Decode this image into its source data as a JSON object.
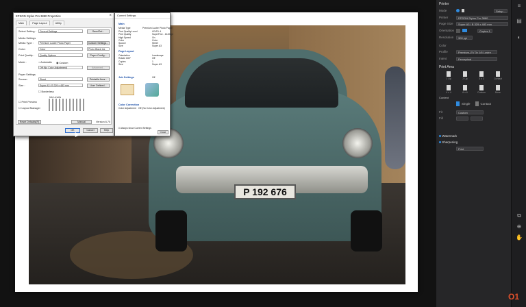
{
  "panel": {
    "title": "Printer",
    "rows": [
      {
        "label": "Mode",
        "value": "",
        "btn": "Setup..."
      },
      {
        "label": "Printer",
        "value": "EPSON Stylus Pro 3880"
      },
      {
        "label": "Page Size",
        "value": "Super A3 / B 329 x 483 mm"
      },
      {
        "label": "Orientation",
        "value": "",
        "extra": "Copies 1"
      },
      {
        "label": "Resolution",
        "value": "300 ppi"
      },
      {
        "label": "Color",
        "value": ""
      },
      {
        "label": "Profile",
        "value": "Premium_EV 3x 1/6 Lustre"
      },
      {
        "label": "Intent",
        "value": "Perceptual"
      }
    ],
    "print_area": "Print Area",
    "tiles": [
      "1 Up",
      "2 Up",
      "3 x 3",
      "Contact",
      "4 x 4",
      "6 x 6",
      "Custom",
      "More"
    ],
    "content": "Content",
    "content_rows": [
      "Single",
      "Contact",
      "Fit",
      "Fill",
      "Custom"
    ],
    "watermark": "Watermark",
    "sharpening": "Sharpening",
    "sharpening_type": "Print"
  },
  "photo": {
    "plate": "P 192 676"
  },
  "dialog1": {
    "title": "EPSON Stylus Pro 3880 Properties",
    "tabs": [
      "Main",
      "Page Layout",
      "Utility"
    ],
    "select_setting": "Select Setting :",
    "select_setting_value": "Current Settings",
    "save_del": "Save/Del...",
    "media_settings": "Media Settings",
    "media_type": "Media Type :",
    "media_type_value": "Premium Lustre Photo Paper",
    "custom_settings": "Custom Settings...",
    "color": "Color :",
    "color_value": "Color",
    "black_ink": "Photo Black Ink",
    "print_quality": "Print Quality :",
    "print_quality_value": "Quality Options",
    "paper_config": "Paper Config...",
    "mode": "Mode :",
    "automatic": "Automatic",
    "custom": "Custom",
    "off": "Off (No Color Adjustment)",
    "advanced": "Advanced...",
    "paper_settings": "Paper Settings",
    "source": "Source :",
    "source_value": "Sheet",
    "printable_area": "Printable Area...",
    "size": "Size :",
    "size_value": "Super A3 / B 329 x 483 mm",
    "user_defined": "User Defined...",
    "borderless": "Borderless",
    "ink_levels": "Ink Levels",
    "print_preview": "Print Preview",
    "layout_manager": "Layout Manager",
    "manual": "Manual",
    "version": "Version 6.70",
    "reset_defaults": "Reset Defaults(R)",
    "ok": "OK",
    "cancel": "Cancel",
    "help": "Help"
  },
  "dialog2": {
    "title": "Current Settings",
    "main": "Main",
    "media_type": "Media Type",
    "media_type_value": "Premium Lustre Photo Paper",
    "labels": "Print Quality Level\nPrint Quality\nHigh Speed\nColor\nSource\nSize",
    "values": "LEVEL 4\nSuperFine - 1440dpi\nOn\nColor\nSheet\nSuper A3",
    "page_layout": "Page Layout",
    "page_labels": "Orientation\nRotate 180°\nCopies\nSize",
    "page_values": "Landscape\nOff\n1\nSuper A3",
    "job_settings": "Job Settings",
    "job_value": "Off",
    "color_correction": "Color Correction",
    "color_adjust": "Color Adjustment",
    "color_adjust_value": "Off (No Color Adjustment)",
    "always_show": "Always show Current Settings",
    "close": "Close"
  }
}
